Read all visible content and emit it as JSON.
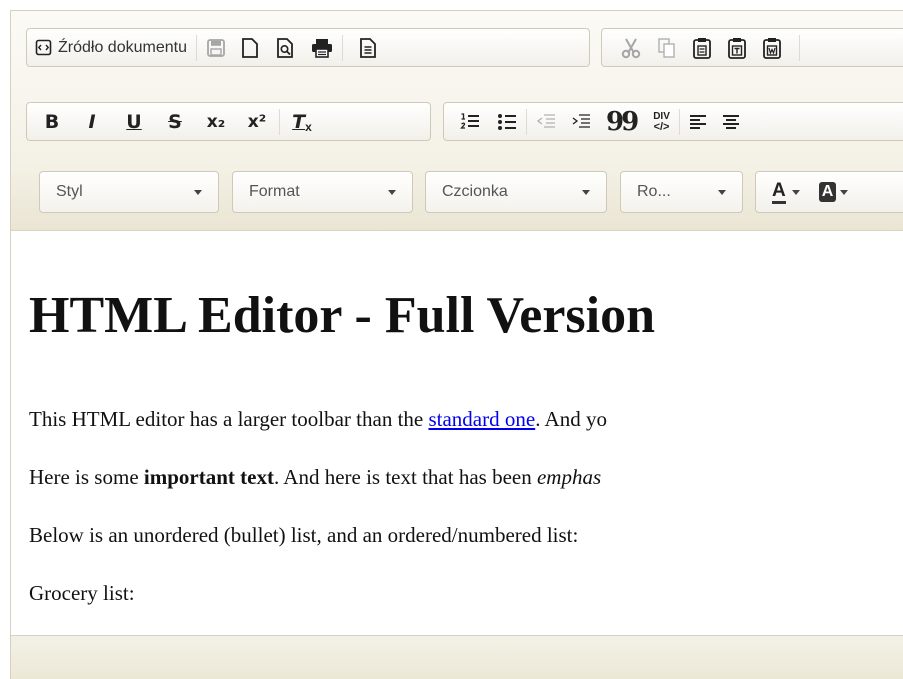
{
  "toolbar": {
    "source_button_label": "Źródło dokumentu",
    "bold_label": "B",
    "italic_label": "I",
    "underline_label": "U",
    "strike_label": "S",
    "subscript_label": "x₂",
    "superscript_label": "x²",
    "remove_format_label": "T",
    "blockquote_label": "99",
    "div_label": "DIV",
    "text_color_label": "A",
    "bg_color_label": "A",
    "combos": {
      "style": "Styl",
      "format": "Format",
      "font": "Czcionka",
      "size": "Ro..."
    }
  },
  "content": {
    "heading": "HTML Editor - Full Version",
    "p1_before": "This HTML editor has a larger toolbar than the ",
    "p1_link": "standard one",
    "p1_after": ". And yo",
    "p2_before": "Here is some ",
    "p2_bold": "important text",
    "p2_middle": ". And here is text that has been ",
    "p2_italic": "emphas",
    "p3": "Below is an unordered (bullet) list, and an ordered/numbered list:",
    "p4": "Grocery list:"
  },
  "colors": {
    "toolbar_bg": "#f4f1e6",
    "border": "#cfcab8",
    "link": "#0000ee",
    "text_color_underline": "#333333"
  }
}
